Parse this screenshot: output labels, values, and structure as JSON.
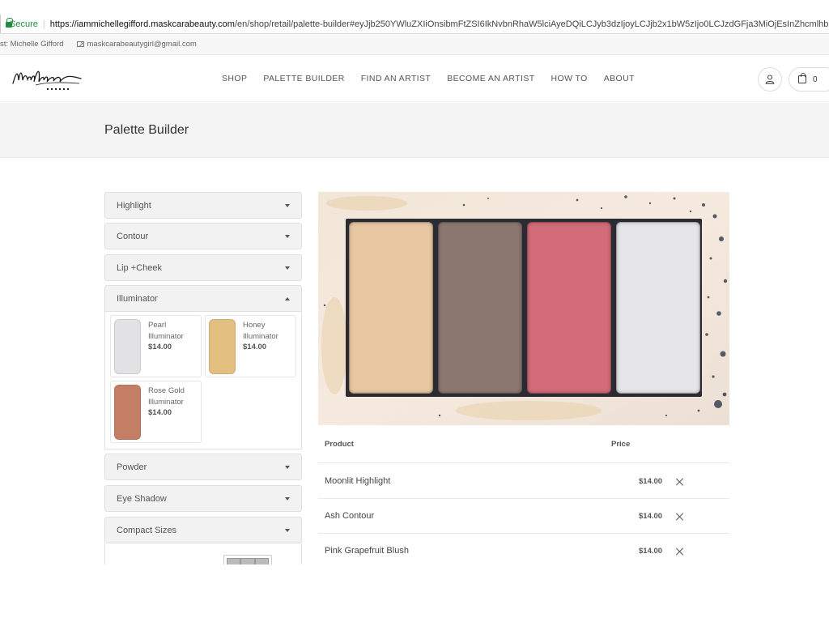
{
  "browser": {
    "secure_label": "Secure",
    "url_host": "https://iammichellegifford.maskcarabeauty.com",
    "url_path": "/en/shop/retail/palette-builder#eyJjb250YWluZXIiOnsibmFtZSI6IkNvbnRhaW5lciAyeDQiLCJyb3dzIjoyLCJjb2x1bW5zIjo0LCJzdGFja3MiOjEsInZhcmlhbnRzIjpbeyJuYW1lIjoiTW"
  },
  "host": {
    "name_label": "st: Michelle Gifford",
    "email": "maskcarabeautygirl@gmail.com"
  },
  "header": {
    "nav": [
      "SHOP",
      "PALETTE BUILDER",
      "FIND AN ARTIST",
      "BECOME AN ARTIST",
      "HOW TO",
      "ABOUT"
    ],
    "cart_count": "0",
    "icons": {
      "user": "user-icon",
      "cart": "shopping-bag-icon"
    }
  },
  "page": {
    "title": "Palette Builder"
  },
  "categories": [
    {
      "label": "Highlight",
      "open": false
    },
    {
      "label": "Contour",
      "open": false
    },
    {
      "label": "Lip +Cheek",
      "open": false
    },
    {
      "label": "Illuminator",
      "open": true
    },
    {
      "label": "Powder",
      "open": false
    },
    {
      "label": "Eye Shadow",
      "open": false
    },
    {
      "label": "Compact Sizes",
      "open": false
    }
  ],
  "illuminator_products": [
    {
      "name": "Pearl Illuminator",
      "price": "$14.00",
      "color": "#e2e2e4"
    },
    {
      "name": "Honey Illuminator",
      "price": "$14.00",
      "color": "#e2c080"
    },
    {
      "name": "Rose Gold Illuminator",
      "price": "$14.00",
      "color": "#c47e66"
    }
  ],
  "palette": {
    "pans": [
      "#e8c8a2",
      "#8c7770",
      "#d36b78",
      "#e6e6e8"
    ]
  },
  "table": {
    "headers": {
      "product": "Product",
      "price": "Price"
    },
    "rows": [
      {
        "product": "Moonlit Highlight",
        "price": "$14.00"
      },
      {
        "product": "Ash Contour",
        "price": "$14.00"
      },
      {
        "product": "Pink Grapefruit Blush",
        "price": "$14.00"
      }
    ]
  }
}
